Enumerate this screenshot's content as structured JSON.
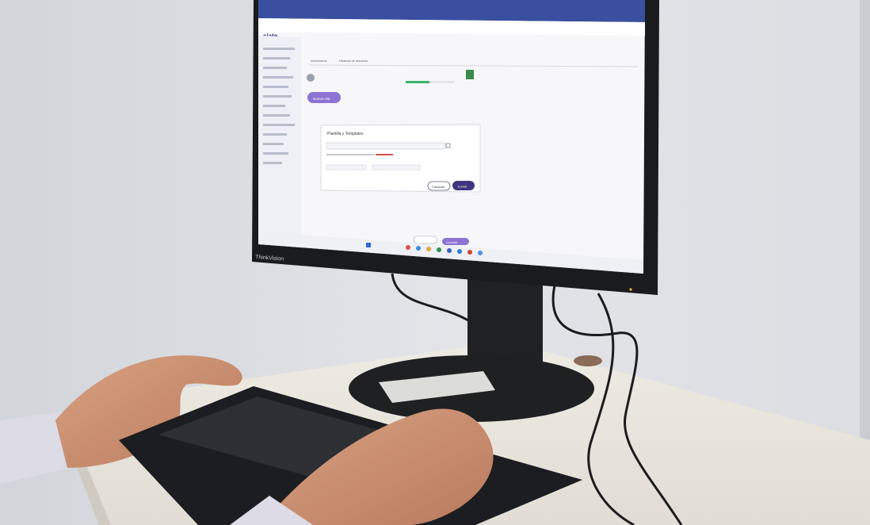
{
  "photo": {
    "monitor_brand": "ThinkVision"
  },
  "screen": {
    "app_logo": "ciate",
    "dialog": {
      "title": "Plantilla y Templates",
      "cancel_label": "Cancelar",
      "confirm_label": "Enviar"
    },
    "tabs": [
      "Informacion",
      "Historial de atencion"
    ],
    "primary_button": "Nueva cita",
    "bottom_button": "Guardar"
  },
  "colors": {
    "wall": "#dfe1e4",
    "desk": "#e9e6df",
    "monitor": "#1a1b1d",
    "accent_purple": "#7a62c9",
    "accent_green": "#38b56a",
    "skin": "#c98e6e",
    "sleeve": "#dcdbe6"
  }
}
